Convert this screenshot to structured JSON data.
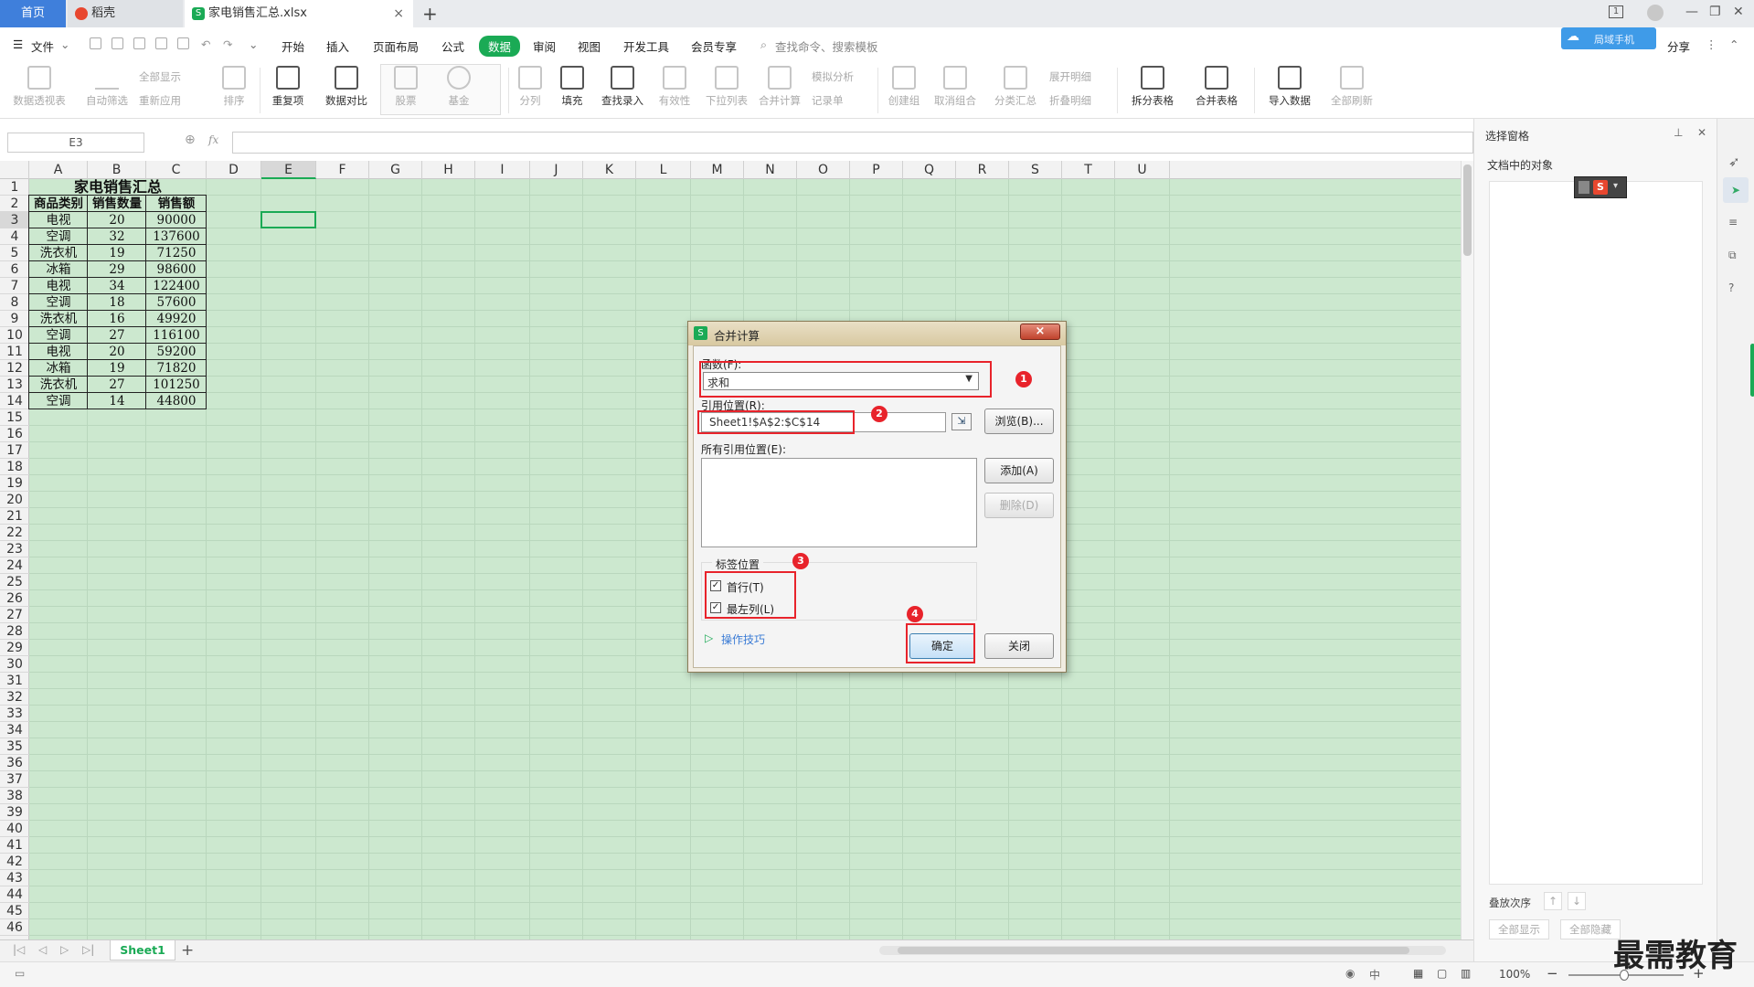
{
  "tabs": {
    "home": "首页",
    "doc": "稻壳",
    "active": "家电销售汇总.xlsx",
    "close": "×",
    "plus": "+"
  },
  "top_right": {
    "badge": "1",
    "cloud_label": "局域手机"
  },
  "menu": {
    "file": "文件",
    "items": [
      "开始",
      "插入",
      "页面布局",
      "公式",
      "数据",
      "审阅",
      "视图",
      "开发工具",
      "会员专享"
    ],
    "active_index": 4,
    "search_placeholder": "查找命令、搜索模板",
    "share": "分享"
  },
  "ribbon": {
    "pivot": "数据透视表",
    "autofilter": "自动筛选",
    "show_all": "全部显示",
    "reapply": "重新应用",
    "sort": "排序",
    "duplicates": "重复项",
    "compare": "数据对比",
    "stock": "股票",
    "fund": "基金",
    "split": "分列",
    "fill": "填充",
    "lookup": "查找录入",
    "validity": "有效性",
    "dropdown": "下拉列表",
    "consolidate": "合并计算",
    "simulate": "模拟分析",
    "record": "记录单",
    "group": "创建组",
    "ungroup": "取消组合",
    "subtotal": "分类汇总",
    "expand": "展开明细",
    "collapse": "折叠明细",
    "split_table": "拆分表格",
    "merge_table": "合并表格",
    "import": "导入数据",
    "refresh_all": "全部刷新"
  },
  "formula_bar": {
    "name_box": "E3",
    "fx": "fx"
  },
  "columns": [
    "A",
    "B",
    "C",
    "D",
    "E",
    "F",
    "G",
    "H",
    "I",
    "J",
    "K",
    "L",
    "M",
    "N",
    "O",
    "P",
    "Q",
    "R",
    "S",
    "T",
    "U"
  ],
  "selected_column": "E",
  "selected_row": 3,
  "rows": [
    "1",
    "2",
    "3",
    "4",
    "5",
    "6",
    "7",
    "8",
    "9",
    "10",
    "11",
    "12",
    "13",
    "14",
    "15",
    "16",
    "17",
    "18",
    "19",
    "20",
    "21",
    "22",
    "23",
    "24",
    "25",
    "26",
    "27",
    "28",
    "29",
    "30",
    "31",
    "32",
    "33",
    "34",
    "35",
    "36",
    "37",
    "38",
    "39",
    "40",
    "41",
    "42",
    "43",
    "44",
    "45",
    "46"
  ],
  "sheet": {
    "title": "家电销售汇总",
    "headers": [
      "商品类别",
      "销售数量",
      "销售额"
    ],
    "data": [
      [
        "电视",
        "20",
        "90000"
      ],
      [
        "空调",
        "32",
        "137600"
      ],
      [
        "洗衣机",
        "19",
        "71250"
      ],
      [
        "冰箱",
        "29",
        "98600"
      ],
      [
        "电视",
        "34",
        "122400"
      ],
      [
        "空调",
        "18",
        "57600"
      ],
      [
        "洗衣机",
        "16",
        "49920"
      ],
      [
        "空调",
        "27",
        "116100"
      ],
      [
        "电视",
        "20",
        "59200"
      ],
      [
        "冰箱",
        "19",
        "71820"
      ],
      [
        "洗衣机",
        "27",
        "101250"
      ],
      [
        "空调",
        "14",
        "44800"
      ]
    ]
  },
  "sheet_tabs": {
    "active": "Sheet1",
    "add": "+"
  },
  "right_pane": {
    "title": "选择窗格",
    "section": "文档中的对象",
    "order_label": "叠放次序",
    "show_all": "全部显示",
    "hide_all": "全部隐藏"
  },
  "dialog": {
    "title": "合并计算",
    "close": "×",
    "function_label": "函数(F):",
    "function_value": "求和",
    "ref_label": "引用位置(R):",
    "ref_value": "Sheet1!$A$2:$C$14",
    "browse": "浏览(B)...",
    "all_refs_label": "所有引用位置(E):",
    "add": "添加(A)",
    "delete": "删除(D)",
    "label_position": "标签位置",
    "top_row": "首行(T)",
    "left_col": "最左列(L)",
    "tips": "操作技巧",
    "ok": "确定",
    "cancel": "关闭",
    "markers": [
      "1",
      "2",
      "3",
      "4"
    ]
  },
  "status": {
    "zoom": "100%",
    "minus": "−",
    "plus": "+"
  },
  "watermark": "最需教育",
  "colors": {
    "accent_green": "#1aaa55",
    "grid_bg": "#cce8cf",
    "annotation_red": "#e8232b",
    "home_tab_blue": "#3f7fdb"
  }
}
